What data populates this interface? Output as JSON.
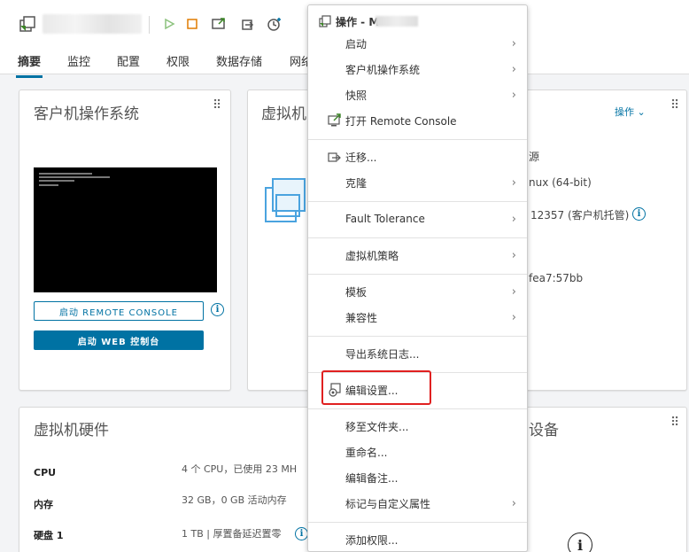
{
  "toolbar": {
    "vm_name_redacted": true,
    "icons": [
      "vm-icon",
      "power-on-icon",
      "power-off-icon",
      "launch-console-icon",
      "migrate-icon",
      "snapshot-icon"
    ]
  },
  "tabs": [
    "摘要",
    "监控",
    "配置",
    "权限",
    "数据存储",
    "网络"
  ],
  "guest_card": {
    "title": "客户机操作系统",
    "remote_console_btn": "启动 REMOTE CONSOLE",
    "web_console_btn": "启动 WEB 控制台"
  },
  "vm_card": {
    "title": "虚拟机",
    "actions_label": "操作",
    "rows": [
      "源",
      "nux (64-bit)",
      "12357 (客户机托管)",
      "fea7:57bb"
    ]
  },
  "hardware_card": {
    "title": "虚拟机硬件",
    "rows": [
      {
        "label": "CPU",
        "value": "4 个 CPU，已使用 23 MH"
      },
      {
        "label": "内存",
        "value": "32 GB，0 GB 活动内存"
      },
      {
        "label": "硬盘 1",
        "value": "1 TB | 厚置备延迟置零"
      }
    ]
  },
  "devices_card": {
    "title": "设备"
  },
  "menu": {
    "header": "操作 - M",
    "items": [
      {
        "label": "启动",
        "submenu": true
      },
      {
        "label": "客户机操作系统",
        "submenu": true
      },
      {
        "label": "快照",
        "submenu": true
      },
      {
        "label": "打开 Remote Console",
        "submenu": false
      },
      {
        "label": "迁移...",
        "submenu": false
      },
      {
        "label": "克隆",
        "submenu": true
      },
      {
        "label": "Fault Tolerance",
        "submenu": true
      },
      {
        "label": "虚拟机策略",
        "submenu": true
      },
      {
        "label": "模板",
        "submenu": true
      },
      {
        "label": "兼容性",
        "submenu": true
      },
      {
        "label": "导出系统日志...",
        "submenu": false
      },
      {
        "label": "编辑设置...",
        "submenu": false
      },
      {
        "label": "移至文件夹...",
        "submenu": false
      },
      {
        "label": "重命名...",
        "submenu": false
      },
      {
        "label": "编辑备注...",
        "submenu": false
      },
      {
        "label": "标记与自定义属性",
        "submenu": true
      },
      {
        "label": "添加权限...",
        "submenu": false
      }
    ]
  },
  "colors": {
    "accent": "#0072a3",
    "highlight": "#e02020",
    "green_icon": "#3c8527",
    "orange_icon": "#e07b00"
  }
}
